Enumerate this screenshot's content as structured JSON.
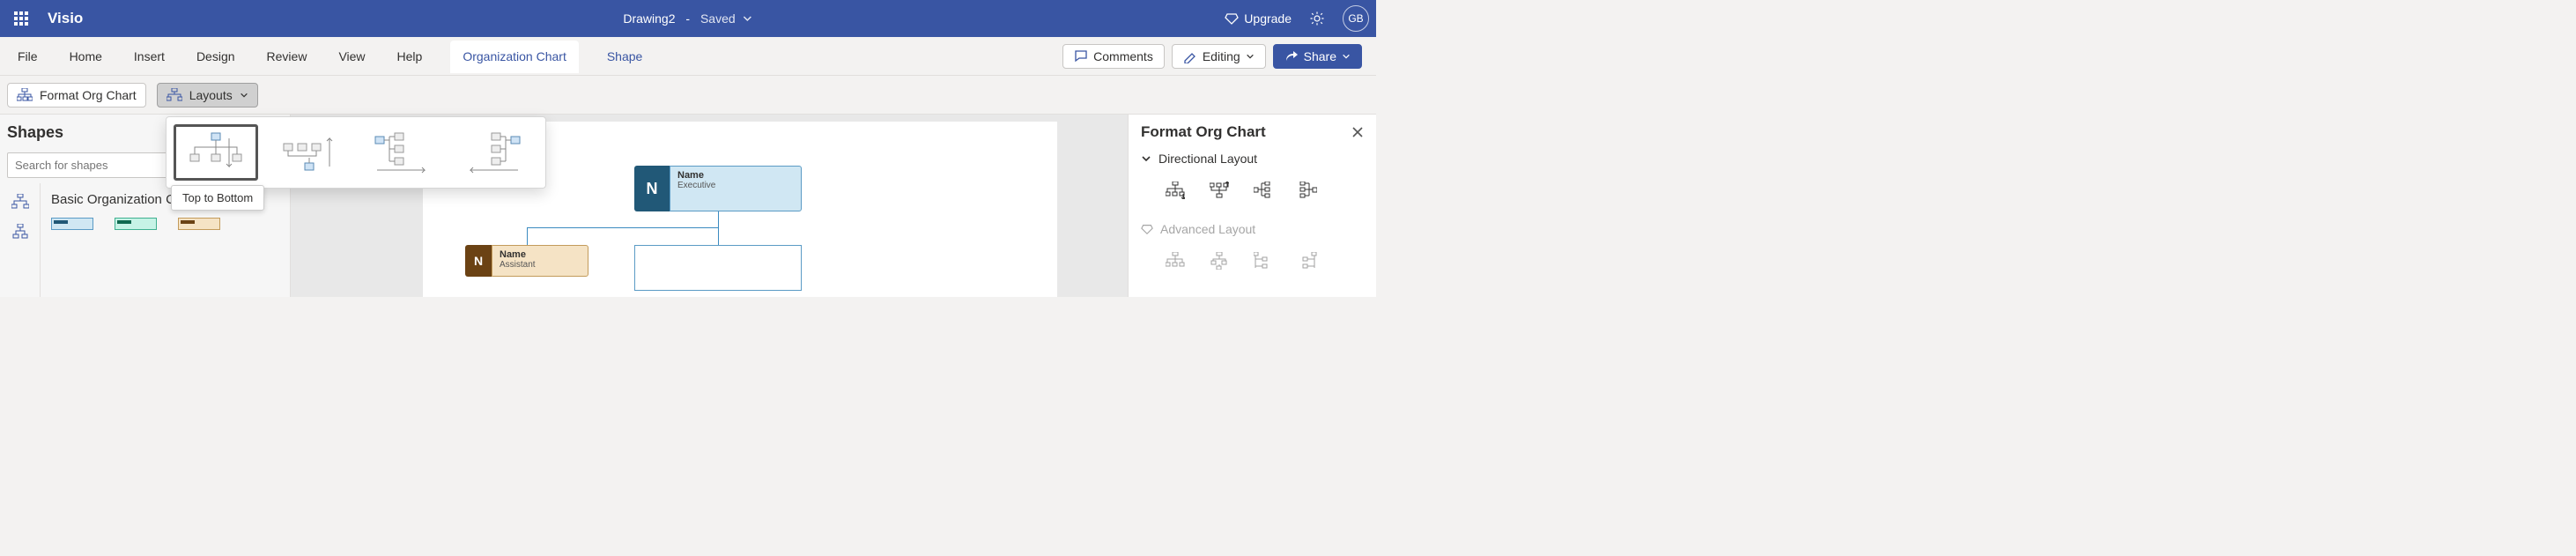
{
  "app": {
    "name": "Visio"
  },
  "document": {
    "name": "Drawing2",
    "status": "Saved"
  },
  "title_actions": {
    "upgrade": "Upgrade",
    "user_initials": "GB"
  },
  "tabs": {
    "file": "File",
    "home": "Home",
    "insert": "Insert",
    "design": "Design",
    "review": "Review",
    "view": "View",
    "help": "Help",
    "orgchart": "Organization Chart",
    "shape": "Shape"
  },
  "ribbon_actions": {
    "comments": "Comments",
    "editing": "Editing",
    "share": "Share"
  },
  "subribbon": {
    "format_org": "Format Org Chart",
    "layouts": "Layouts"
  },
  "layouts_popover": {
    "tooltip": "Top to Bottom"
  },
  "shapes_panel": {
    "title": "Shapes",
    "search_placeholder": "Search for shapes",
    "stencil_title": "Basic Organization Chart"
  },
  "canvas": {
    "exec": {
      "initial": "N",
      "name": "Name",
      "role": "Executive"
    },
    "assist": {
      "initial": "N",
      "name": "Name",
      "role": "Assistant"
    }
  },
  "format_pane": {
    "title": "Format Org Chart",
    "section_directional": "Directional Layout",
    "section_advanced": "Advanced Layout"
  }
}
